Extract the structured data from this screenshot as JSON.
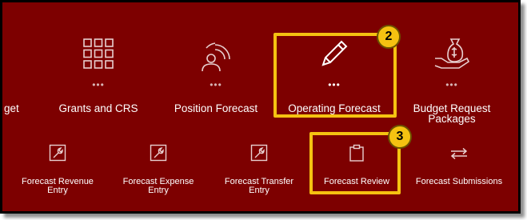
{
  "top_row": [
    {
      "label": "get",
      "icon": "partial-tile"
    },
    {
      "label": "Grants and CRS",
      "icon": "grid-icon"
    },
    {
      "label": "Position Forecast",
      "icon": "person-signal-icon"
    },
    {
      "label": "Operating Forecast",
      "icon": "pencil-icon"
    },
    {
      "label": "Budget Request Packages",
      "icon": "hand-money-bag-icon"
    }
  ],
  "bottom_row": [
    {
      "label": "Forecast Revenue Entry",
      "icon": "wrench-doc-icon"
    },
    {
      "label": "Forecast Expense Entry",
      "icon": "wrench-doc-icon"
    },
    {
      "label": "Forecast Transfer Entry",
      "icon": "wrench-doc-icon"
    },
    {
      "label": "Forecast Review",
      "icon": "clipboard-icon"
    },
    {
      "label": "Forecast Submissions",
      "icon": "exchange-arrows-icon"
    }
  ],
  "dots": "•••",
  "callouts": [
    {
      "number": "2",
      "target": "Operating Forecast"
    },
    {
      "number": "3",
      "target": "Forecast Review"
    }
  ],
  "colors": {
    "background": "#7d0000",
    "highlight": "#f5c211",
    "text": "#ffffff"
  }
}
